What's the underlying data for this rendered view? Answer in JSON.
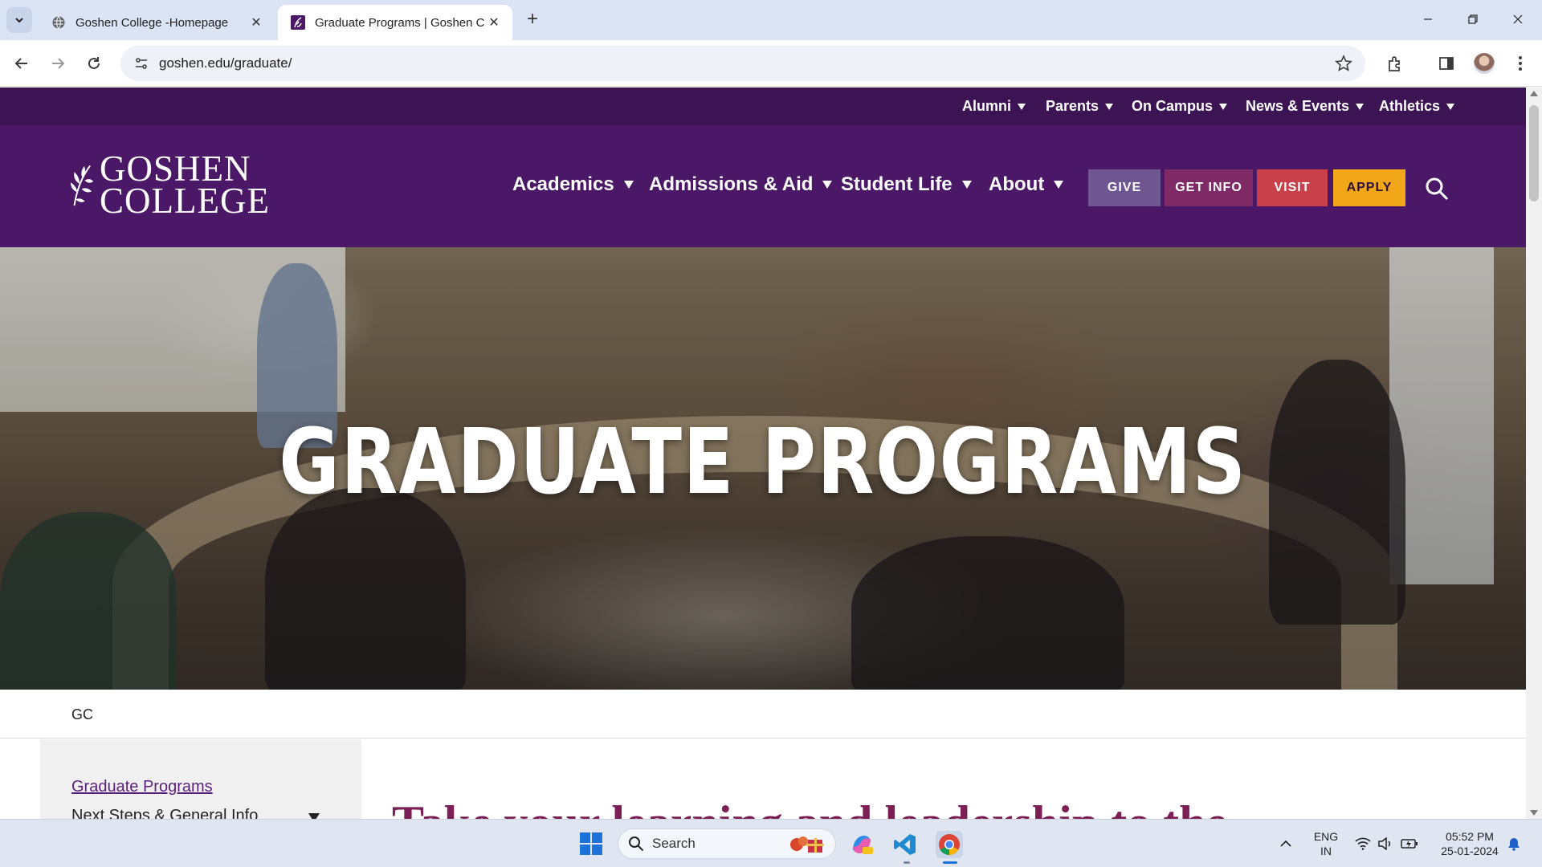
{
  "browser": {
    "tabs": [
      {
        "title": "Goshen College -Homepage",
        "active": false
      },
      {
        "title": "Graduate Programs | Goshen C",
        "active": true
      }
    ],
    "url": "goshen.edu/graduate/"
  },
  "site": {
    "utility_nav": [
      "Alumni",
      "Parents",
      "On Campus",
      "News & Events",
      "Athletics"
    ],
    "logo": {
      "line1": "GOSHEN",
      "line2": "COLLEGE"
    },
    "main_nav": [
      "Academics",
      "Admissions & Aid",
      "Student Life",
      "About"
    ],
    "cta_buttons": {
      "give": "GIVE",
      "get_info": "GET INFO",
      "visit": "VISIT",
      "apply": "APPLY"
    },
    "hero_title": "GRADUATE PROGRAMS",
    "breadcrumb": "GC",
    "sidebar": {
      "current": "Graduate Programs",
      "next": "Next Steps & General Info"
    },
    "heading": "Take your learning and leadership to the"
  },
  "taskbar": {
    "search_placeholder": "Search",
    "language": {
      "line1": "ENG",
      "line2": "IN"
    },
    "time": "05:52 PM",
    "date": "25-01-2024"
  },
  "colors": {
    "utility_bar": "#3c1353",
    "header": "#4a1866",
    "give": "#6e5690",
    "get_info": "#7e2a67",
    "visit": "#c93f4a",
    "apply": "#f2a71b",
    "heading": "#7c1f55"
  },
  "icons": [
    "tab-search-icon",
    "globe-icon",
    "goshen-favicon",
    "close-icon",
    "plus-icon",
    "minimize-icon",
    "restore-icon",
    "back-icon",
    "forward-icon",
    "reload-icon",
    "site-info-icon",
    "star-icon",
    "extensions-icon",
    "side-panel-icon",
    "menu-icon",
    "search-icon",
    "windows-start-icon",
    "chevron-up-icon",
    "wifi-icon",
    "volume-icon",
    "battery-icon",
    "notification-bell-icon"
  ]
}
